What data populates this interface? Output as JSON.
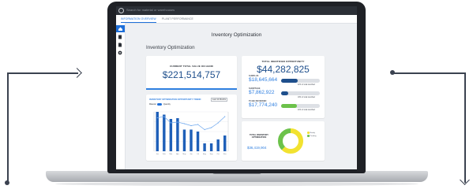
{
  "topbar": {
    "search_placeholder": "Search for material or warehouses"
  },
  "tabs": [
    {
      "label": "INFORMATION OVERVIEW",
      "active": true
    },
    {
      "label": "PLANT PERFORMANCE",
      "active": false
    }
  ],
  "sidenav": {
    "items": [
      "home-icon",
      "building-icon",
      "document-icon",
      "settings-icon"
    ]
  },
  "page_title": "Inventory Optimization",
  "section_title": "Inventory Optimization",
  "kpi_left": {
    "label": "CURRENT TOTAL VALUE ON HAND",
    "value": "$221,514,757"
  },
  "kpi_right": {
    "label": "TOTAL IDENTIFIED OPPORTUNITY",
    "value": "$44,282,825"
  },
  "opportunities": [
    {
      "label": "SURPLUS",
      "value": "$18,645,664",
      "fill": 0.42,
      "color": "#1e4f8c",
      "note": "42% of total identified"
    },
    {
      "label": "SHORTAGE",
      "value": "$7,862,922",
      "fill": 0.18,
      "color": "#1e4f8c",
      "note": "18% of total identified"
    },
    {
      "label": "TO BE REVIEWED",
      "value": "$17,774,240",
      "fill": 0.4,
      "color": "#6cc24a",
      "note": "40% of total identified"
    }
  ],
  "chart_data": {
    "type": "bar",
    "title": "INVENTORY OPTIMIZATION OPPORTUNITY TREND",
    "categories": [
      "Jan",
      "Feb",
      "Mar",
      "Apr",
      "May",
      "Jun",
      "Jul",
      "Aug",
      "Sep",
      "Oct",
      "Nov"
    ],
    "series": [
      {
        "values": [
          1.0,
          0.93,
          0.82,
          0.84,
          0.55,
          0.55,
          0.5,
          0.2,
          0.2,
          0.3,
          0.4
        ],
        "color": "#2f7fe0"
      },
      {
        "values": [
          0.85,
          0.88,
          0.72,
          0.74,
          0.7,
          0.65,
          0.68,
          0.55,
          0.6,
          0.72,
          0.88
        ],
        "color": "#2f7fe0"
      }
    ],
    "controls": {
      "range": "Last 12 Months",
      "left_option": "Material",
      "right_option": "Quantity"
    }
  },
  "donut": {
    "label": "TOTAL INVENTORY OPTIMIZATION",
    "value": "$36,419,904",
    "slices": [
      {
        "name": "Ready",
        "value": 0.62,
        "color": "#f2e230"
      },
      {
        "name": "Pending",
        "value": 0.38,
        "color": "#6cc24a"
      }
    ]
  }
}
